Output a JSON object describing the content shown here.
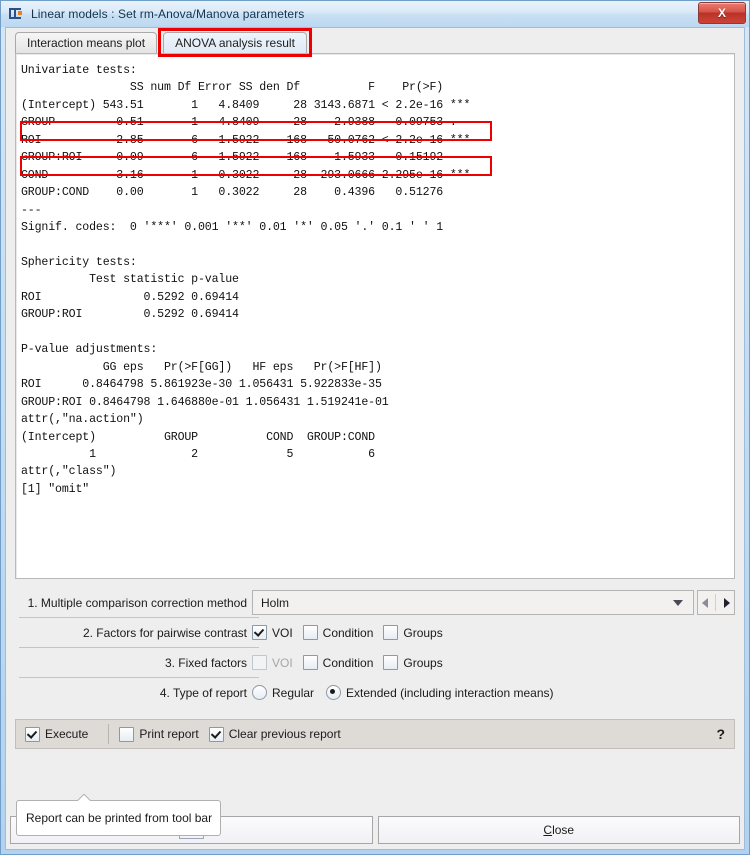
{
  "window": {
    "title": "Linear models : Set rm-Anova/Manova parameters",
    "app_icon": "linear-models-icon",
    "close_label": "X"
  },
  "tabs": [
    {
      "label": "Interaction means plot",
      "active": false
    },
    {
      "label": "ANOVA analysis result",
      "active": true,
      "annotated": true
    }
  ],
  "report": {
    "text": "Univariate tests:\n                SS num Df Error SS den Df          F    Pr(>F)\n(Intercept) 543.51       1   4.8409     28 3143.6871 < 2.2e-16 ***\nGROUP         0.51       1   4.8409     28    2.9388   0.09753 .\nROI           2.85       6   1.5922    168   50.0762 < 2.2e-16 ***\nGROUP:ROI     0.09       6   1.5922    168    1.5933   0.15192\nCOND          3.16       1   0.3022     28  293.0666 2.295e-16 ***\nGROUP:COND    0.00       1   0.3022     28    0.4396   0.51276\n---\nSignif. codes:  0 '***' 0.001 '**' 0.01 '*' 0.05 '.' 0.1 ' ' 1\n\nSphericity tests:\n          Test statistic p-value\nROI               0.5292 0.69414\nGROUP:ROI         0.5292 0.69414\n\nP-value adjustments:\n            GG eps   Pr(>F[GG])   HF eps   Pr(>F[HF])\nROI      0.8464798 5.861923e-30 1.056431 5.922833e-35\nGROUP:ROI 0.8464798 1.646880e-01 1.056431 1.519241e-01\nattr(,\"na.action\")\n(Intercept)          GROUP          COND  GROUP:COND\n          1              2             5           6\nattr(,\"class\")\n[1] \"omit\"",
    "highlight_color": "#ee0000",
    "highlighted_rows": [
      "ROI",
      "COND"
    ]
  },
  "options": {
    "row1": {
      "label": "1. Multiple comparison correction method",
      "value": "Holm"
    },
    "row2": {
      "label": "2. Factors for pairwise contrast",
      "checkboxes": [
        {
          "label": "VOI",
          "checked": true,
          "disabled": false
        },
        {
          "label": "Condition",
          "checked": false,
          "disabled": false
        },
        {
          "label": "Groups",
          "checked": false,
          "disabled": false
        }
      ]
    },
    "row3": {
      "label": "3. Fixed factors",
      "checkboxes": [
        {
          "label": "VOI",
          "checked": false,
          "disabled": true
        },
        {
          "label": "Condition",
          "checked": false,
          "disabled": false
        },
        {
          "label": "Groups",
          "checked": false,
          "disabled": false
        }
      ]
    },
    "row4": {
      "label": "4. Type of report",
      "radios": [
        {
          "label": "Regular",
          "selected": false
        },
        {
          "label": "Extended (including interaction means)",
          "selected": true
        }
      ]
    }
  },
  "actionbar": {
    "execute": {
      "label": "Execute",
      "checked": true
    },
    "print_report": {
      "label": "Print report",
      "checked": false
    },
    "clear_previous": {
      "label": "Clear previous report",
      "checked": true
    },
    "help_label": "?"
  },
  "tooltip": {
    "text": "Report can be printed from tool bar"
  },
  "buttons": {
    "ok": {
      "prefix": "O",
      "suffix": "k"
    },
    "close": {
      "prefix": "C",
      "suffix": "lose"
    }
  }
}
